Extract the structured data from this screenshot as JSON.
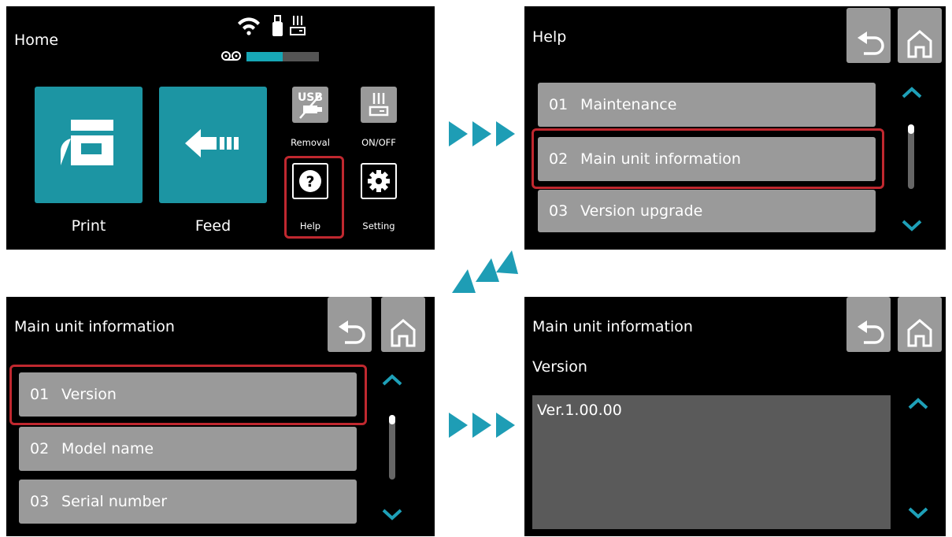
{
  "home": {
    "title": "Home",
    "ink_level": 0.5,
    "buttons": {
      "print": "Print",
      "feed": "Feed",
      "removal": "Removal",
      "onoff": "ON/OFF",
      "help": "Help",
      "setting": "Setting"
    },
    "usb_text": "USB"
  },
  "help": {
    "title": "Help",
    "items": [
      {
        "num": "01",
        "label": "Maintenance"
      },
      {
        "num": "02",
        "label": "Main unit information"
      },
      {
        "num": "03",
        "label": "Version upgrade"
      }
    ]
  },
  "main_info": {
    "title": "Main unit information",
    "items": [
      {
        "num": "01",
        "label": "Version"
      },
      {
        "num": "02",
        "label": "Model name"
      },
      {
        "num": "03",
        "label": "Serial number"
      }
    ]
  },
  "version_screen": {
    "title": "Main unit information",
    "subtitle": "Version",
    "value": "Ver.1.00.00"
  },
  "colors": {
    "accent": "#1c95a3",
    "highlight": "#c0282f",
    "button_gray": "#9a9a9a",
    "arrow": "#1e9db5"
  }
}
